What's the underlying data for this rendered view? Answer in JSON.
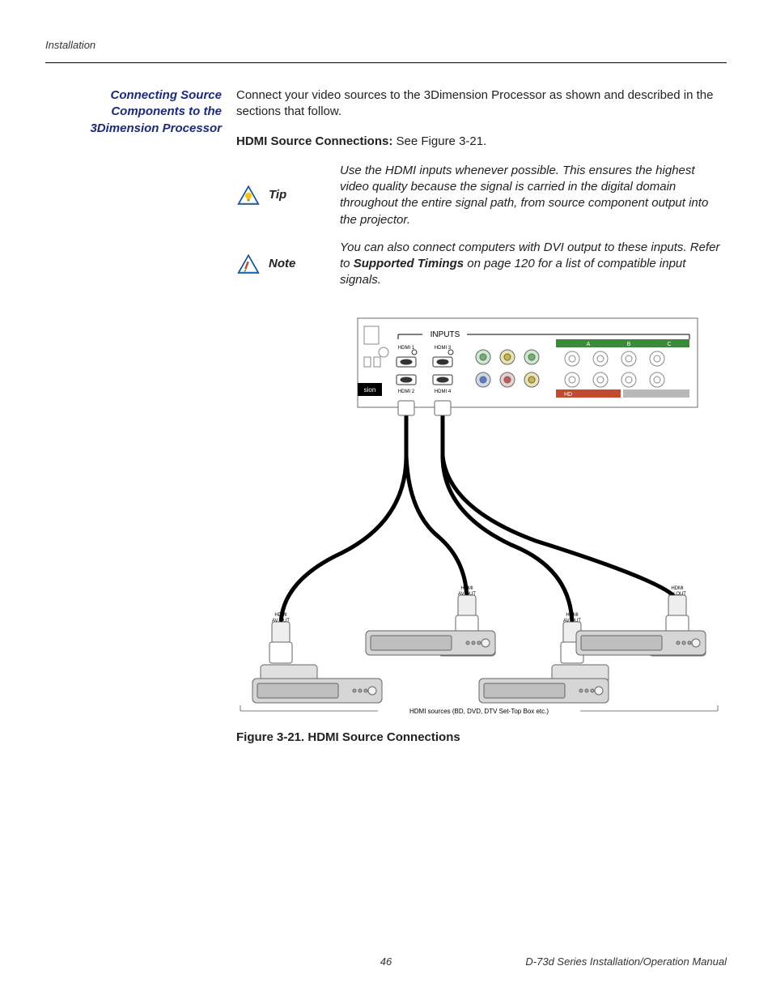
{
  "header": {
    "section": "Installation"
  },
  "sidebar": {
    "heading": "Connecting Source Components to the 3Dimension Processor"
  },
  "body": {
    "intro": "Connect your video sources to the 3Dimension Processor as shown and described in the sections that follow.",
    "subhead_label": "HDMI Source Connections:",
    "subhead_rest": " See Figure 3-21."
  },
  "callouts": {
    "tip": {
      "label": "Tip",
      "text": "Use the HDMI inputs whenever possible. This ensures the highest video quality because the signal is carried in the digital domain throughout the entire signal path, from source component output into the projector."
    },
    "note": {
      "label": "Note",
      "pre": "You can also connect computers with DVI output to these inputs. Refer to ",
      "strong": "Supported Timings",
      "post": " on page 120 for a list of compatible input signals."
    }
  },
  "figure": {
    "caption": "Figure 3-21. HDMI Source Connections",
    "panel": {
      "inputs_label": "INPUTS",
      "hdmi1": "HDMI 1",
      "hdmi2": "HDMI 2",
      "hdmi3": "HDMI 3",
      "hdmi4": "HDMI 4",
      "sion": "sion",
      "a": "A",
      "b": "B",
      "c": "C",
      "hd": "HD"
    },
    "conn": {
      "hdmi_av_out": "HDMI\nAV OUT"
    },
    "bottom_label": "HDMI sources (BD, DVD, DTV Set-Top Box etc.)"
  },
  "footer": {
    "page": "46",
    "doc": "D-73d Series Installation/Operation Manual"
  }
}
